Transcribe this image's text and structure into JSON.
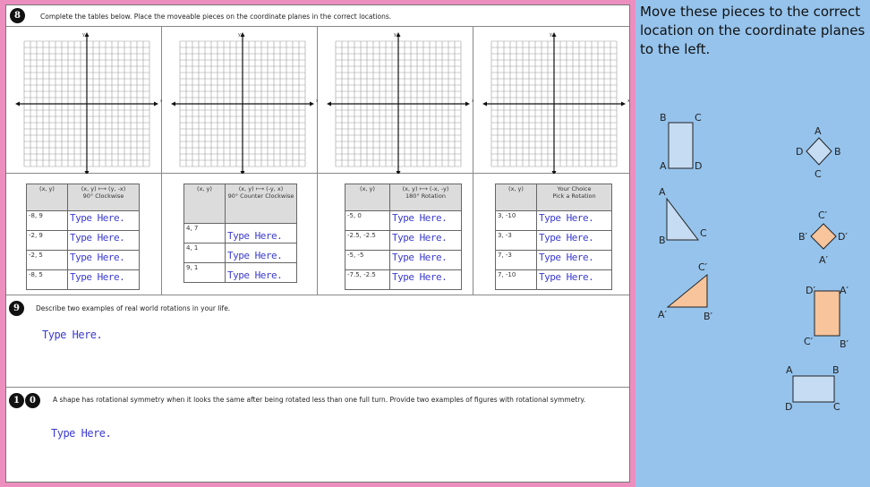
{
  "q8": {
    "number": "8",
    "text": "Complete the tables below. Place the moveable pieces on the coordinate planes in the correct locations."
  },
  "grid_axes": {
    "x_label": "x",
    "y_label": "y"
  },
  "tables": [
    {
      "col1": "(x, y)",
      "col2_line1": "(x, y) ⟼ (y, -x)",
      "col2_line2": "90° Clockwise",
      "rows": [
        {
          "xy": "-8, 9",
          "ans": "Type Here."
        },
        {
          "xy": "-2, 9",
          "ans": "Type Here."
        },
        {
          "xy": "-2, 5",
          "ans": "Type Here."
        },
        {
          "xy": "-8, 5",
          "ans": "Type Here."
        }
      ]
    },
    {
      "col1": "(x, y)",
      "col2_line1": "(x, y) ⟼ (-y, x)",
      "col2_line2": "90° Counter Clockwise",
      "rows": [
        {
          "xy": "4, 7",
          "ans": "Type Here."
        },
        {
          "xy": "4, 1",
          "ans": "Type Here."
        },
        {
          "xy": "9, 1",
          "ans": "Type Here."
        }
      ]
    },
    {
      "col1": "(x, y)",
      "col2_line1": "(x, y) ⟼ (-x, -y)",
      "col2_line2": "180° Rotation",
      "rows": [
        {
          "xy": "-5, 0",
          "ans": "Type Here."
        },
        {
          "xy": "-2.5, -2.5",
          "ans": "Type Here."
        },
        {
          "xy": "-5, -5",
          "ans": "Type Here."
        },
        {
          "xy": "-7.5, -2.5",
          "ans": "Type Here."
        }
      ]
    },
    {
      "col1": "(x, y)",
      "col2_line1": "Your Choice",
      "col2_line2": "Pick a Rotation",
      "rows": [
        {
          "xy": "3, -10",
          "ans": "Type Here."
        },
        {
          "xy": "3, -3",
          "ans": "Type Here."
        },
        {
          "xy": "7, -3",
          "ans": "Type Here."
        },
        {
          "xy": "7, -10",
          "ans": "Type Here."
        }
      ]
    }
  ],
  "q9": {
    "number": "9",
    "text": "Describe two examples of real world rotations in your life.",
    "answer": "Type Here."
  },
  "q10": {
    "number": "10",
    "text": "A shape has rotational symmetry when it looks the same after being rotated less than one full turn.  Provide two examples of figures with rotational symmetry.",
    "answer": "Type Here."
  },
  "panel": {
    "instruction": "Move these pieces to the correct location on the coordinate planes to the left."
  },
  "pieces": {
    "rect_blue": {
      "a": "A",
      "b": "B",
      "c": "C",
      "d": "D"
    },
    "diamond_blue": {
      "a": "A",
      "b": "B",
      "c": "C",
      "d": "D"
    },
    "triangle_blue": {
      "a": "A",
      "b": "B",
      "c": "C"
    },
    "diamond_orange": {
      "a": "A′",
      "b": "B′",
      "c": "C′",
      "d": "D′"
    },
    "triangle_orange": {
      "a": "A′",
      "b": "B′",
      "c": "C′"
    },
    "rect_orange": {
      "a": "A′",
      "b": "B′",
      "c": "C′",
      "d": "D′"
    },
    "rect_blue_wide": {
      "a": "A",
      "b": "B",
      "c": "C",
      "d": "D"
    }
  },
  "colors": {
    "pink_border": "#ec8fbf",
    "panel_blue": "#95c3ec",
    "piece_blue": "#c6dcf3",
    "piece_orange": "#f7c49c",
    "answer_blue": "#3b3bcf"
  }
}
